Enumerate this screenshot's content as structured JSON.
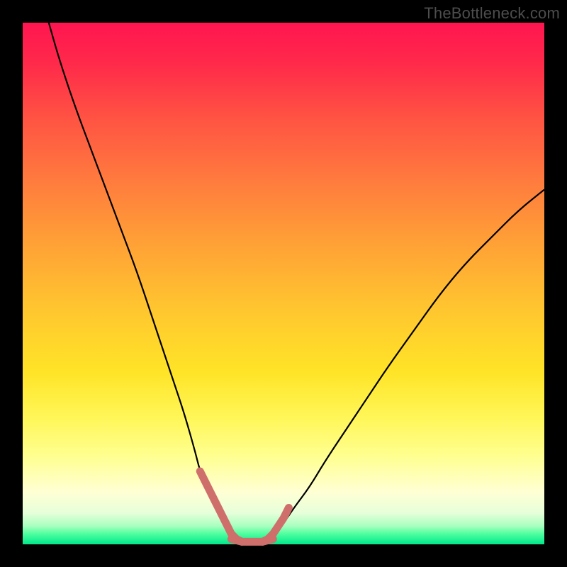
{
  "watermark": {
    "text": "TheBottleneck.com"
  },
  "chart_data": {
    "type": "line",
    "title": "",
    "xlabel": "",
    "ylabel": "",
    "xlim": [
      0,
      100
    ],
    "ylim": [
      0,
      100
    ],
    "grid": false,
    "legend": false,
    "background_gradient": {
      "stops": [
        {
          "pos": 0,
          "color": "#ff1550"
        },
        {
          "pos": 0.3,
          "color": "#ff7a3e"
        },
        {
          "pos": 0.6,
          "color": "#ffe427"
        },
        {
          "pos": 0.9,
          "color": "#ffffd4"
        },
        {
          "pos": 1.0,
          "color": "#00e88a"
        }
      ]
    },
    "series": [
      {
        "name": "left-curve",
        "stroke": "#000000",
        "stroke_width": 2.2,
        "x": [
          5,
          7,
          10,
          13,
          16,
          19,
          22,
          25,
          27,
          29,
          31,
          33,
          34,
          35,
          36,
          37,
          38,
          39,
          40
        ],
        "y": [
          100,
          93,
          84,
          76,
          68,
          60,
          52,
          43,
          37,
          31,
          25,
          18,
          14,
          12,
          10,
          8,
          6,
          4,
          2
        ]
      },
      {
        "name": "right-curve",
        "stroke": "#000000",
        "stroke_width": 2.2,
        "x": [
          48,
          50,
          52,
          55,
          58,
          62,
          66,
          70,
          75,
          80,
          85,
          90,
          95,
          100
        ],
        "y": [
          2,
          4,
          7,
          11,
          16,
          22,
          28,
          34,
          41,
          48,
          54,
          59,
          64,
          68
        ]
      },
      {
        "name": "valley-highlight-left",
        "stroke": "#cf6f6b",
        "stroke_width": 11,
        "linecap": "round",
        "x": [
          34,
          35,
          36,
          37,
          38,
          39,
          40,
          41,
          42
        ],
        "y": [
          14,
          12,
          10,
          8,
          6,
          4,
          2,
          1,
          0.5
        ]
      },
      {
        "name": "valley-highlight-bottom",
        "stroke": "#cf6f6b",
        "stroke_width": 11,
        "linecap": "round",
        "x": [
          40,
          42,
          44,
          46,
          48
        ],
        "y": [
          1,
          0.5,
          0.5,
          0.5,
          1
        ]
      },
      {
        "name": "valley-highlight-right",
        "stroke": "#cf6f6b",
        "stroke_width": 11,
        "linecap": "round",
        "x": [
          46,
          47,
          48,
          49,
          50,
          51
        ],
        "y": [
          0.5,
          1,
          2,
          3.5,
          5,
          7
        ]
      }
    ]
  }
}
